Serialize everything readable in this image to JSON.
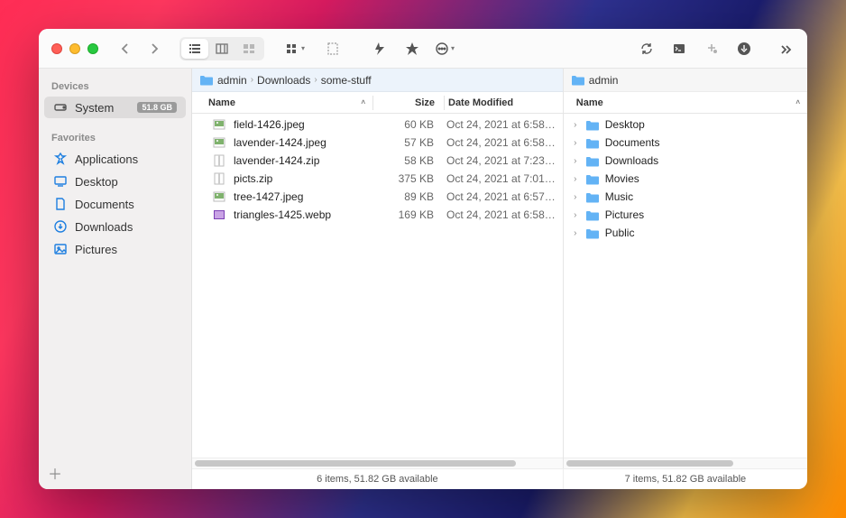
{
  "sidebar": {
    "devices_label": "Devices",
    "system_label": "System",
    "system_badge": "51.8 GB",
    "favorites_label": "Favorites",
    "applications_label": "Applications",
    "desktop_label": "Desktop",
    "documents_label": "Documents",
    "downloads_label": "Downloads",
    "pictures_label": "Pictures"
  },
  "panes": {
    "left": {
      "path": {
        "root": "admin",
        "mid": "Downloads",
        "leaf": "some-stuff"
      },
      "header": {
        "name": "Name",
        "size": "Size",
        "date": "Date Modified"
      },
      "rows": [
        {
          "name": "field-1426.jpeg",
          "size": "60 KB",
          "date": "Oct 24, 2021 at 6:58…",
          "kind": "jpeg"
        },
        {
          "name": "lavender-1424.jpeg",
          "size": "57 KB",
          "date": "Oct 24, 2021 at 6:58…",
          "kind": "jpeg"
        },
        {
          "name": "lavender-1424.zip",
          "size": "58 KB",
          "date": "Oct 24, 2021 at 7:23…",
          "kind": "zip"
        },
        {
          "name": "picts.zip",
          "size": "375 KB",
          "date": "Oct 24, 2021 at 7:01…",
          "kind": "zip"
        },
        {
          "name": "tree-1427.jpeg",
          "size": "89 KB",
          "date": "Oct 24, 2021 at 6:57…",
          "kind": "jpeg"
        },
        {
          "name": "triangles-1425.webp",
          "size": "169 KB",
          "date": "Oct 24, 2021 at 6:58…",
          "kind": "webp"
        }
      ],
      "status": "6 items, 51.82 GB available"
    },
    "right": {
      "path": {
        "root": "admin"
      },
      "header": {
        "name": "Name"
      },
      "rows": [
        {
          "name": "Desktop"
        },
        {
          "name": "Documents"
        },
        {
          "name": "Downloads"
        },
        {
          "name": "Movies"
        },
        {
          "name": "Music"
        },
        {
          "name": "Pictures"
        },
        {
          "name": "Public"
        }
      ],
      "status": "7 items, 51.82 GB available"
    }
  }
}
